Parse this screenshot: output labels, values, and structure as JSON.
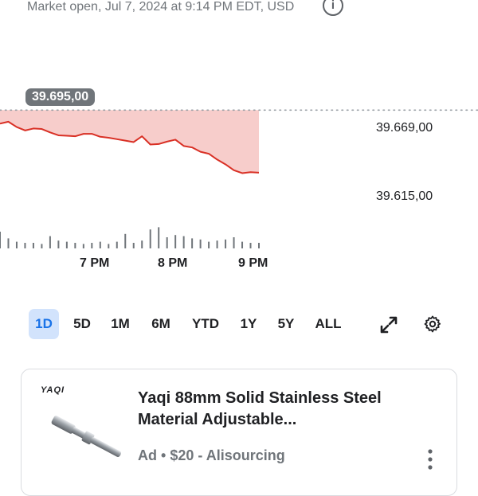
{
  "header": {
    "status_text": "Market open, Jul 7, 2024 at 9:14 PM EDT, USD",
    "info_icon": "info-icon"
  },
  "chart_data": {
    "type": "line",
    "x": [
      "6:40 PM",
      "6:45 PM",
      "6:50 PM",
      "6:55 PM",
      "7:00 PM",
      "7:05 PM",
      "7:10 PM",
      "7:15 PM",
      "7:20 PM",
      "7:25 PM",
      "7:30 PM",
      "7:35 PM",
      "7:40 PM",
      "7:45 PM",
      "7:50 PM",
      "7:55 PM",
      "8:00 PM",
      "8:05 PM",
      "8:10 PM",
      "8:15 PM",
      "8:20 PM",
      "8:25 PM",
      "8:30 PM",
      "8:35 PM",
      "8:40 PM",
      "8:45 PM",
      "8:50 PM",
      "8:55 PM",
      "9:00 PM",
      "9:05 PM",
      "9:10 PM",
      "9:14 PM"
    ],
    "values": [
      39681.0,
      39683.0,
      39677.5,
      39674.0,
      39676.0,
      39675.5,
      39672.0,
      39669.0,
      39668.5,
      39668.0,
      39670.5,
      39670.5,
      39667.5,
      39666.5,
      39665.0,
      39663.5,
      39662.0,
      39668.0,
      39659.5,
      39660.0,
      39662.5,
      39664.5,
      39658.0,
      39656.5,
      39652.0,
      39650.0,
      39644.0,
      39639.0,
      39633.0,
      39630.0,
      39631.0,
      39630.5
    ],
    "volume": [
      30,
      18,
      12,
      10,
      10,
      8,
      22,
      14,
      12,
      10,
      8,
      10,
      12,
      8,
      12,
      26,
      10,
      14,
      34,
      38,
      20,
      24,
      22,
      18,
      16,
      12,
      14,
      16,
      20,
      12,
      10,
      10
    ],
    "previous_close": 39695.0,
    "previous_close_label": "39.695,00",
    "ylim": [
      39600,
      39710
    ],
    "y_ticks": [
      {
        "value": 39669.0,
        "label": "39.669,00"
      },
      {
        "value": 39615.0,
        "label": "39.615,00"
      }
    ],
    "x_ticks": [
      {
        "at": "7:00 PM",
        "label": "7 PM"
      },
      {
        "at": "8:00 PM",
        "label": "8 PM"
      },
      {
        "at": "9:00 PM",
        "label": "9 PM"
      }
    ],
    "colors": {
      "line": "#d93025",
      "fill": "#f6c4c2",
      "volume": "#70757a",
      "baseline": "#9aa0a6"
    }
  },
  "ranges": {
    "items": [
      "1D",
      "5D",
      "1M",
      "6M",
      "YTD",
      "1Y",
      "5Y",
      "ALL"
    ],
    "active": "1D"
  },
  "chart_tools": {
    "expand_icon": "expand-icon",
    "settings_icon": "gear-icon"
  },
  "ad": {
    "brand": "YAQI",
    "title": "Yaqi 88mm Solid Stainless Steel Material Adjustable...",
    "ad_label": "Ad",
    "price": "$20",
    "seller": "- Alisourcing",
    "more_icon": "more-vert-icon"
  },
  "colors": {
    "accent": "#1a73e8",
    "active_bg": "#d2e3fc",
    "muted": "#70757a"
  }
}
